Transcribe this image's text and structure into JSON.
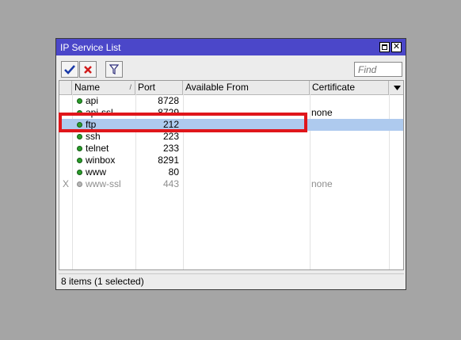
{
  "window": {
    "title": "IP Service List"
  },
  "toolbar": {
    "enable_icon": "check-icon",
    "disable_icon": "x-icon",
    "filter_icon": "filter-icon",
    "find_placeholder": "Find"
  },
  "table": {
    "columns": [
      "Name",
      "Port",
      "Available From",
      "Certificate"
    ],
    "rows": [
      {
        "flag": "",
        "name": "api",
        "port": "8728",
        "certificate": ""
      },
      {
        "flag": "",
        "name": "api-ssl",
        "port": "8729",
        "certificate": "none"
      },
      {
        "flag": "",
        "name": "ftp",
        "port": "212",
        "certificate": ""
      },
      {
        "flag": "",
        "name": "ssh",
        "port": "223",
        "certificate": ""
      },
      {
        "flag": "",
        "name": "telnet",
        "port": "233",
        "certificate": ""
      },
      {
        "flag": "",
        "name": "winbox",
        "port": "8291",
        "certificate": ""
      },
      {
        "flag": "",
        "name": "www",
        "port": "80",
        "certificate": ""
      },
      {
        "flag": "X",
        "name": "www-ssl",
        "port": "443",
        "certificate": "none"
      }
    ]
  },
  "status": {
    "text": "8 items (1 selected)"
  },
  "colors": {
    "titlebar": "#4b47c9",
    "selected_row": "#aecaee",
    "highlight_box": "#e0161b",
    "status_dot": "#2a9d2a"
  }
}
